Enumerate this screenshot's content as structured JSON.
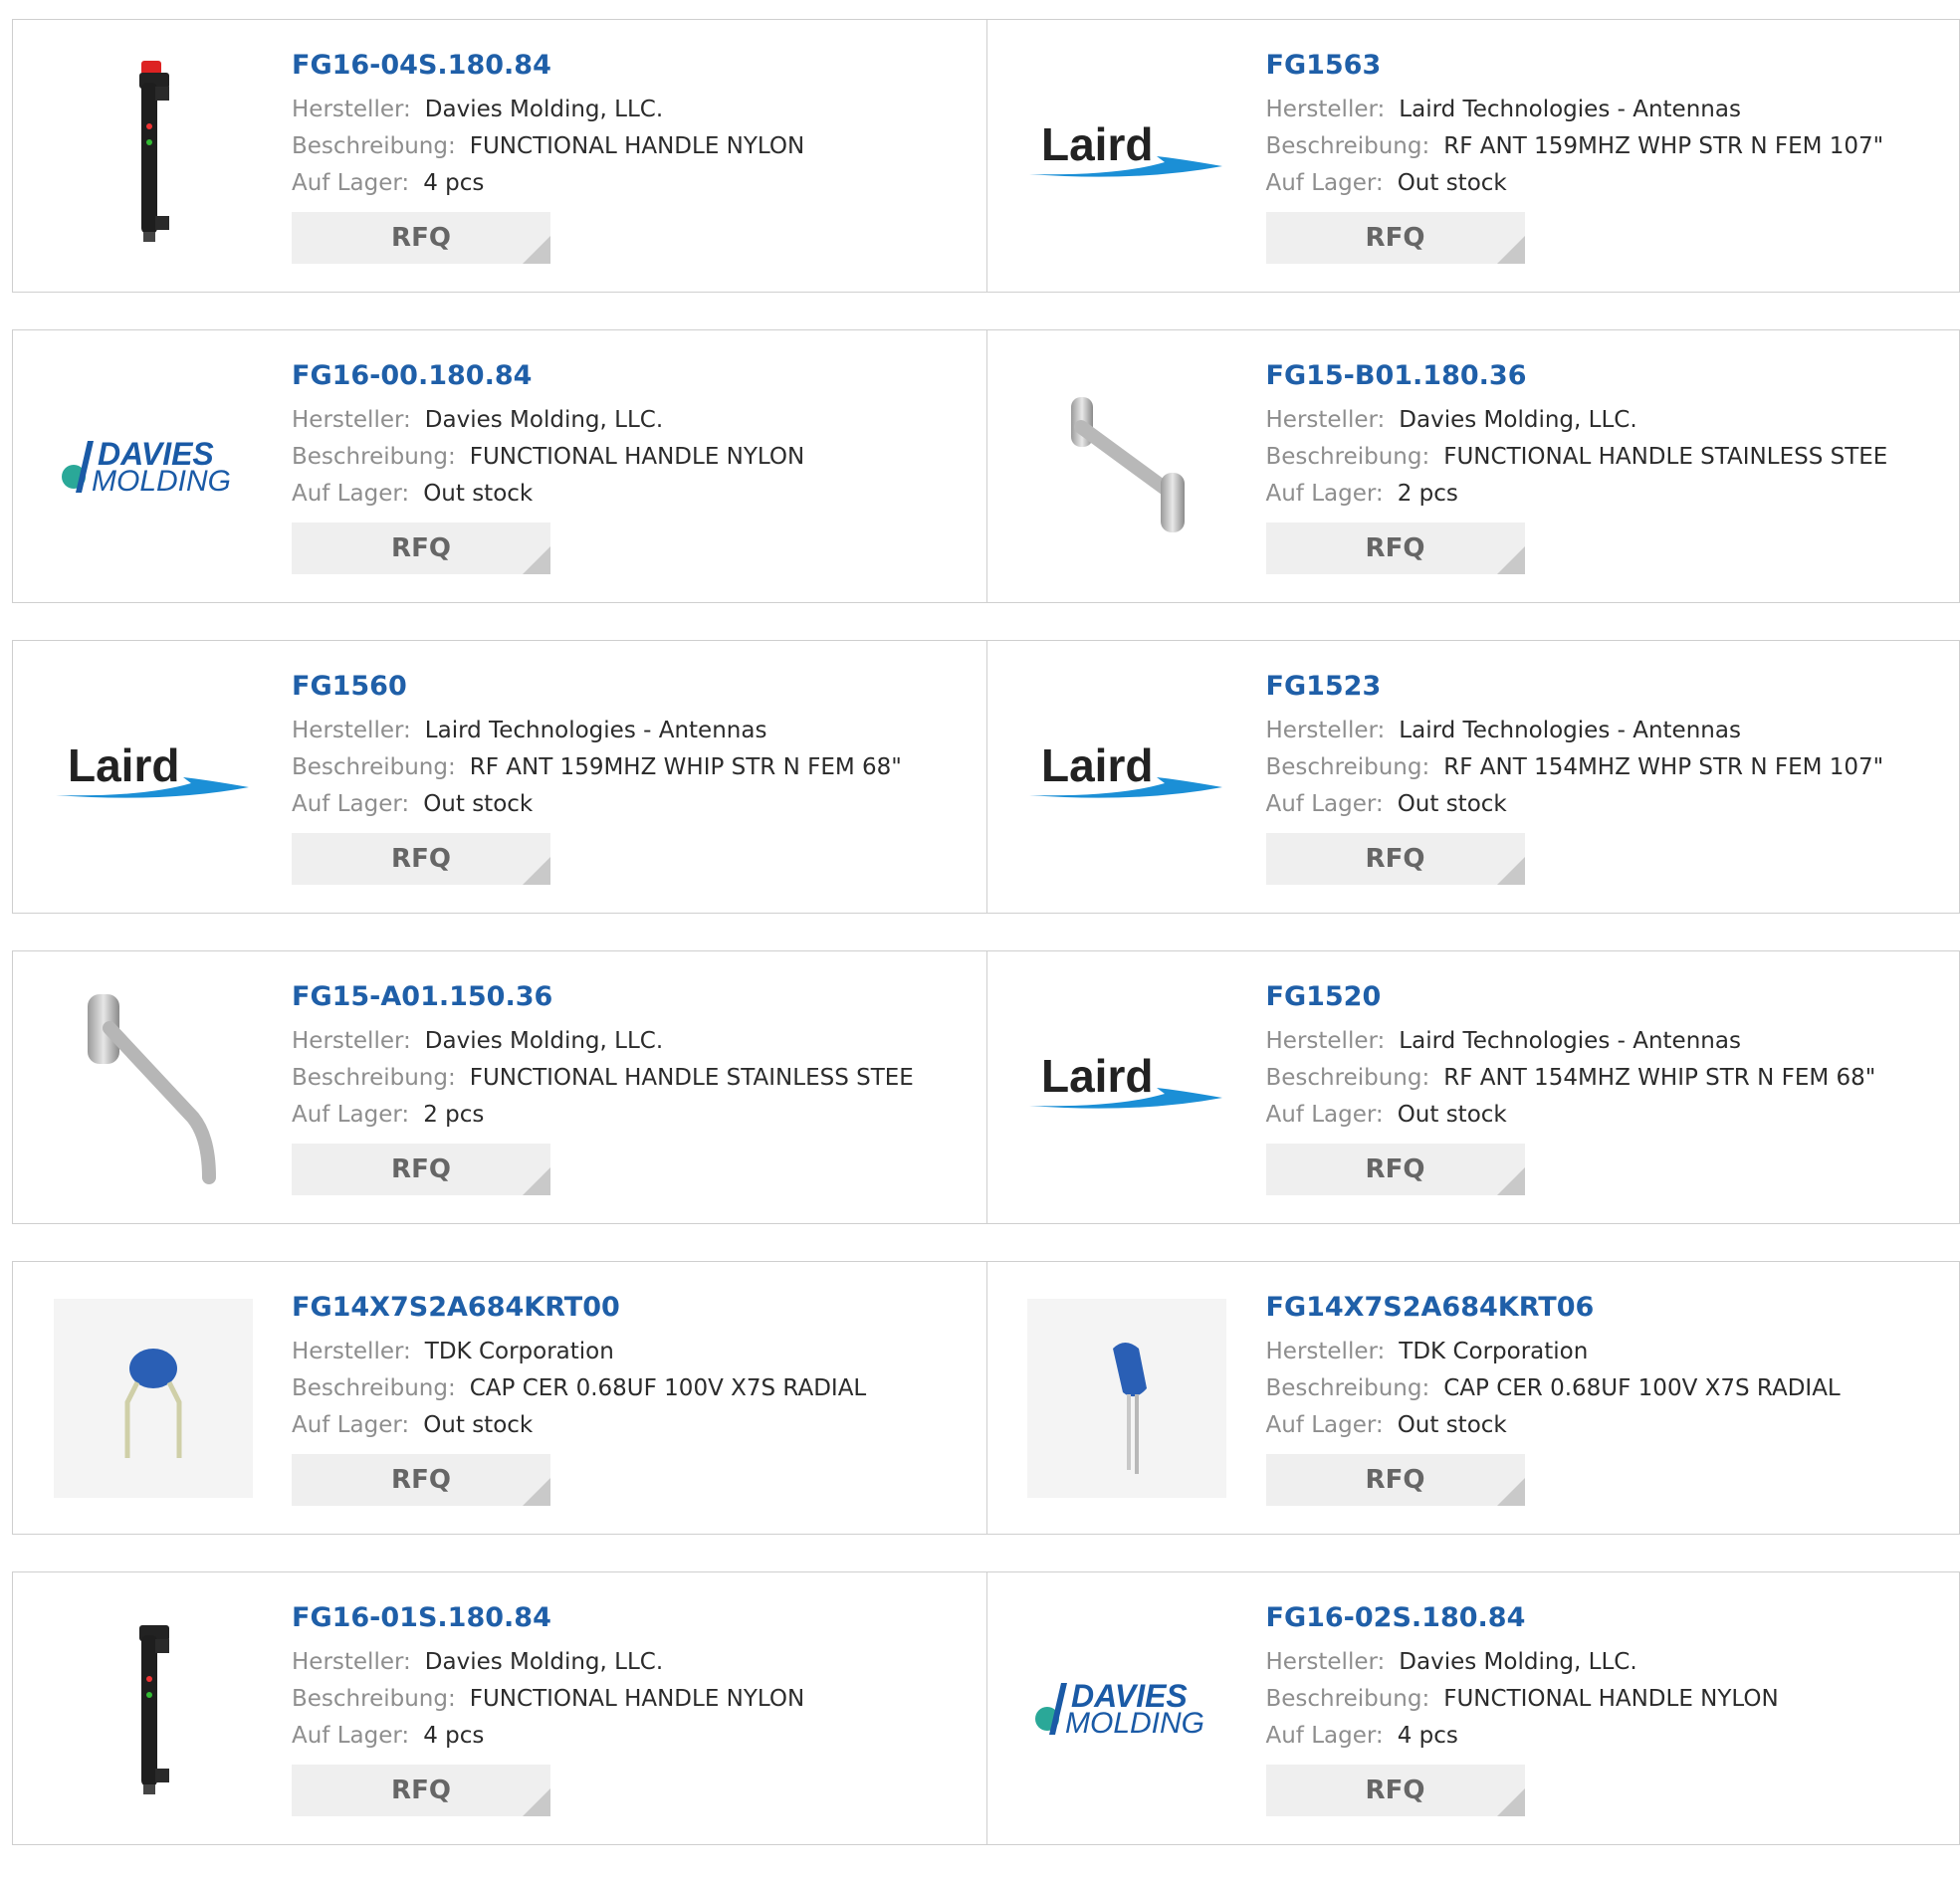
{
  "labels": {
    "manufacturer": "Hersteller:",
    "description": "Beschreibung:",
    "stock": "Auf Lager:",
    "rfq": "RFQ"
  },
  "products": [
    {
      "part": "FG16-04S.180.84",
      "manufacturer": "Davies Molding, LLC.",
      "description": "FUNCTIONAL HANDLE NYLON",
      "stock": "4 pcs",
      "image": "black-handle-estop-image"
    },
    {
      "part": "FG1563",
      "manufacturer": "Laird Technologies - Antennas",
      "description": "RF ANT 159MHZ WHP STR N FEM 107\"",
      "stock": "Out stock",
      "image": "laird-logo",
      "logo_text": "Laird"
    },
    {
      "part": "FG16-00.180.84",
      "manufacturer": "Davies Molding, LLC.",
      "description": "FUNCTIONAL HANDLE NYLON",
      "stock": "Out stock",
      "image": "davies-molding-logo",
      "logo_text": [
        "DAVIES",
        "MOLDING"
      ]
    },
    {
      "part": "FG15-B01.180.36",
      "manufacturer": "Davies Molding, LLC.",
      "description": "FUNCTIONAL HANDLE STAINLESS STEE",
      "stock": "2 pcs",
      "image": "steel-handle-image"
    },
    {
      "part": "FG1560",
      "manufacturer": "Laird Technologies - Antennas",
      "description": "RF ANT 159MHZ WHIP STR N FEM 68\"",
      "stock": "Out stock",
      "image": "laird-logo",
      "logo_text": "Laird"
    },
    {
      "part": "FG1523",
      "manufacturer": "Laird Technologies - Antennas",
      "description": "RF ANT 154MHZ WHP STR N FEM 107\"",
      "stock": "Out stock",
      "image": "laird-logo",
      "logo_text": "Laird"
    },
    {
      "part": "FG15-A01.150.36",
      "manufacturer": "Davies Molding, LLC.",
      "description": "FUNCTIONAL HANDLE STAINLESS STEE",
      "stock": "2 pcs",
      "image": "steel-bent-handle-image"
    },
    {
      "part": "FG1520",
      "manufacturer": "Laird Technologies - Antennas",
      "description": "RF ANT 154MHZ WHIP STR N FEM 68\"",
      "stock": "Out stock",
      "image": "laird-logo",
      "logo_text": "Laird"
    },
    {
      "part": "FG14X7S2A684KRT00",
      "manufacturer": "TDK Corporation",
      "description": "CAP CER 0.68UF 100V X7S RADIAL",
      "stock": "Out stock",
      "image": "capacitor-image"
    },
    {
      "part": "FG14X7S2A684KRT06",
      "manufacturer": "TDK Corporation",
      "description": "CAP CER 0.68UF 100V X7S RADIAL",
      "stock": "Out stock",
      "image": "capacitor-side-image"
    },
    {
      "part": "FG16-01S.180.84",
      "manufacturer": "Davies Molding, LLC.",
      "description": "FUNCTIONAL HANDLE NYLON",
      "stock": "4 pcs",
      "image": "black-handle-image"
    },
    {
      "part": "FG16-02S.180.84",
      "manufacturer": "Davies Molding, LLC.",
      "description": "FUNCTIONAL HANDLE NYLON",
      "stock": "4 pcs",
      "image": "davies-molding-logo",
      "logo_text": [
        "DAVIES",
        "MOLDING"
      ]
    }
  ],
  "colors": {
    "part_link": "#1f5fa8",
    "label": "#8e8e8e",
    "laird_blue": "#1b8fd6",
    "davies_blue": "#1a5aa6",
    "davies_teal": "#2aa898",
    "capacitor_blue": "#2a5fb5"
  }
}
